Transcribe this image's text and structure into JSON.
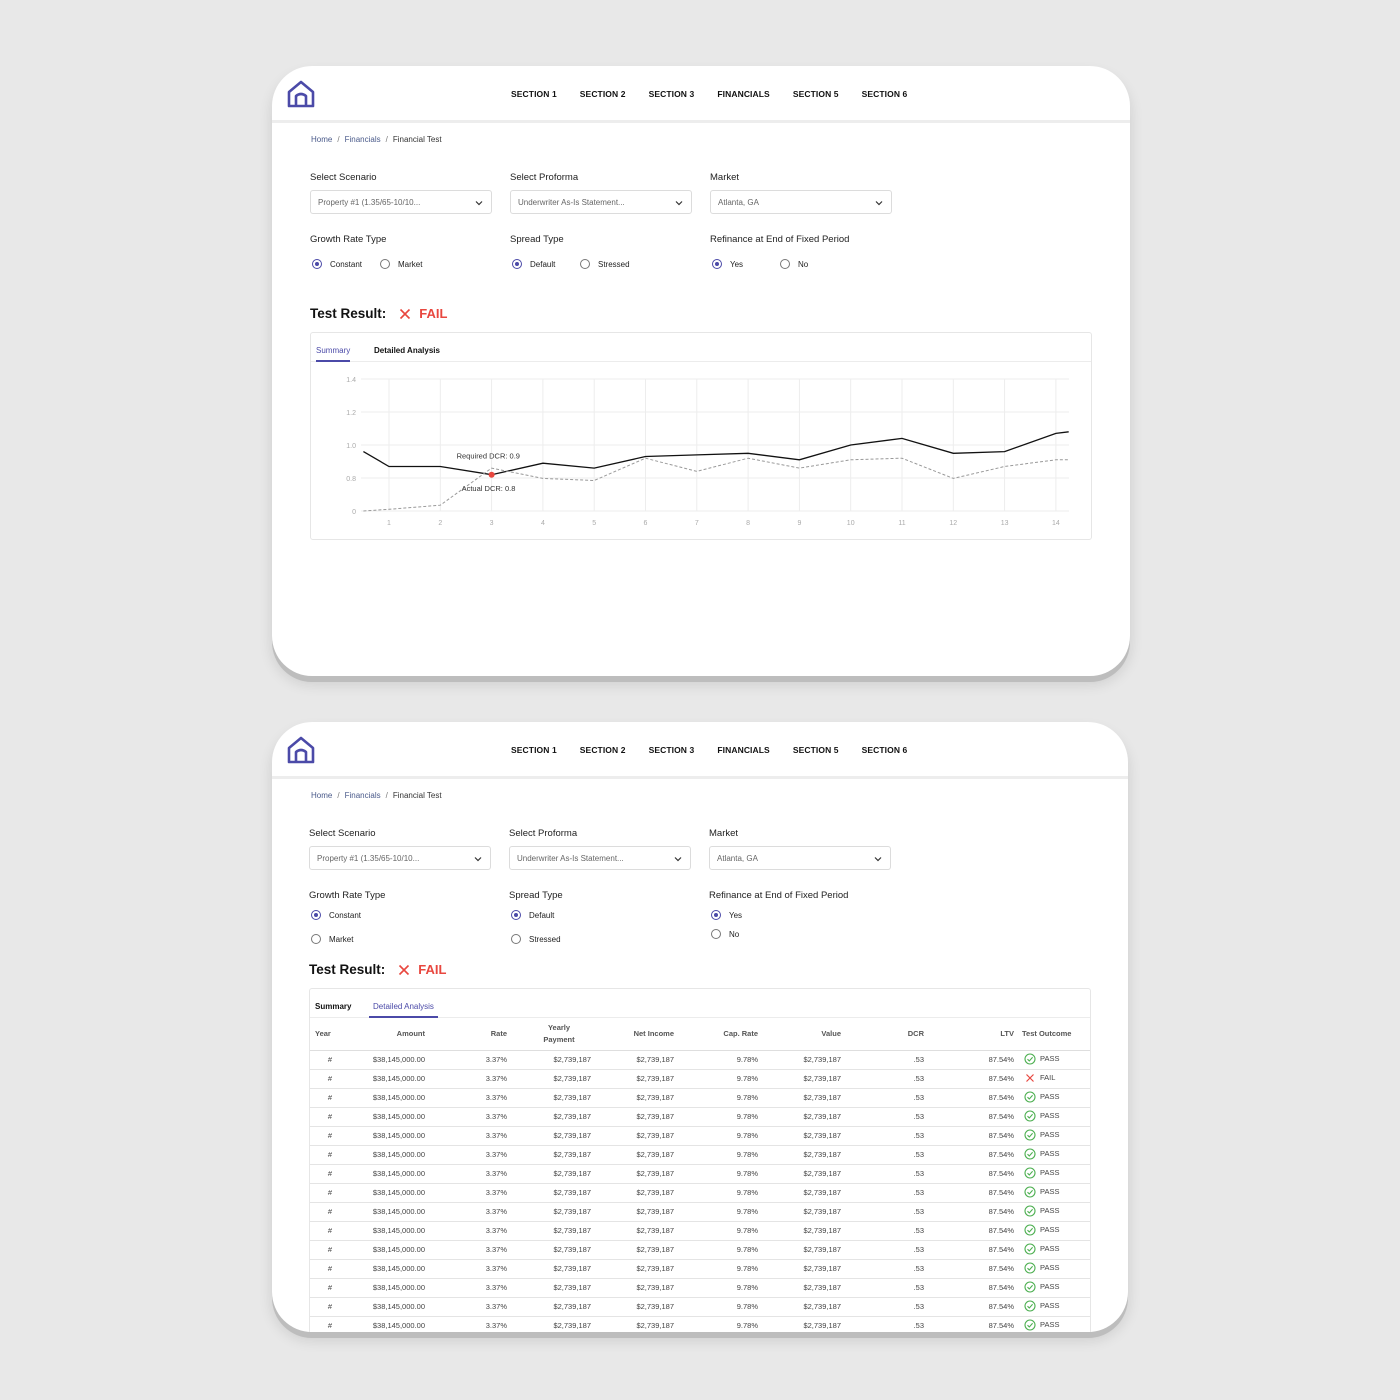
{
  "nav": {
    "logo_icon": "home-icon",
    "links": [
      "SECTION 1",
      "SECTION 2",
      "SECTION 3",
      "FINANCIALS",
      "SECTION 5",
      "SECTION 6"
    ]
  },
  "breadcrumb": {
    "home": "Home",
    "financials": "Financials",
    "current": "Financial Test",
    "sep": "/"
  },
  "filters": {
    "scenario_label": "Select Scenario",
    "scenario_value": "Property #1 (1.35/65-10/10...",
    "proforma_label": "Select Proforma",
    "proforma_value": "Underwriter As-Is Statement...",
    "market_label": "Market",
    "market_value": "Atlanta, GA",
    "growth_label": "Growth Rate Type",
    "growth_options": [
      "Constant",
      "Market"
    ],
    "growth_selected": "Constant",
    "spread_label": "Spread Type",
    "spread_options": [
      "Default",
      "Stressed"
    ],
    "spread_selected": "Default",
    "refi_label": "Refinance at End of Fixed Period",
    "refi_options": [
      "Yes",
      "No"
    ],
    "refi_selected": "Yes"
  },
  "result": {
    "label": "Test Result:",
    "status": "FAIL",
    "status_color": "#e8473f"
  },
  "tabs": {
    "summary": "Summary",
    "detailed": "Detailed Analysis"
  },
  "colors": {
    "accent": "#4b4aa8",
    "pass": "#4caf50",
    "fail": "#e8473f"
  },
  "chart_data": {
    "type": "line",
    "x": [
      0.5,
      1,
      2,
      3,
      4,
      5,
      6,
      7,
      8,
      9,
      10,
      11,
      12,
      13,
      14,
      14.25
    ],
    "x_tick_labels": [
      "1",
      "2",
      "3",
      "4",
      "5",
      "6",
      "7",
      "8",
      "9",
      "10",
      "11",
      "12",
      "13",
      "14"
    ],
    "y_tick_labels": [
      "0",
      "0.8",
      "1.0",
      "1.2",
      "1.4"
    ],
    "series": [
      {
        "style": "solid",
        "color": "#111111",
        "values": [
          0.96,
          0.87,
          0.87,
          0.82,
          0.89,
          0.86,
          0.93,
          0.94,
          0.95,
          0.91,
          1.0,
          1.04,
          0.95,
          0.96,
          1.07,
          1.08
        ]
      },
      {
        "style": "dashed",
        "color": "#999999",
        "values": [
          0.0,
          0.04,
          0.14,
          0.86,
          0.79,
          0.74,
          0.92,
          0.84,
          0.92,
          0.86,
          0.91,
          0.92,
          0.79,
          0.87,
          0.91,
          0.91
        ]
      }
    ],
    "annotations": [
      {
        "text": "Required DCR: 0.9"
      },
      {
        "text": "Actual DCR: 0.8"
      }
    ],
    "highlight": {
      "x": 3,
      "y": 0.82,
      "color": "#e8473f"
    },
    "grid": true
  },
  "table": {
    "headers": [
      "Year",
      "Amount",
      "Rate",
      "Yearly Payment",
      "Net Income",
      "Cap. Rate",
      "Value",
      "DCR",
      "LTV",
      "Test Outcome"
    ],
    "rows": [
      [
        "#",
        "$38,145,000.00",
        "3.37%",
        "$2,739,187",
        "$2,739,187",
        "9.78%",
        "$2,739,187",
        ".53",
        "87.54%",
        "PASS"
      ],
      [
        "#",
        "$38,145,000.00",
        "3.37%",
        "$2,739,187",
        "$2,739,187",
        "9.78%",
        "$2,739,187",
        ".53",
        "87.54%",
        "FAIL"
      ],
      [
        "#",
        "$38,145,000.00",
        "3.37%",
        "$2,739,187",
        "$2,739,187",
        "9.78%",
        "$2,739,187",
        ".53",
        "87.54%",
        "PASS"
      ],
      [
        "#",
        "$38,145,000.00",
        "3.37%",
        "$2,739,187",
        "$2,739,187",
        "9.78%",
        "$2,739,187",
        ".53",
        "87.54%",
        "PASS"
      ],
      [
        "#",
        "$38,145,000.00",
        "3.37%",
        "$2,739,187",
        "$2,739,187",
        "9.78%",
        "$2,739,187",
        ".53",
        "87.54%",
        "PASS"
      ],
      [
        "#",
        "$38,145,000.00",
        "3.37%",
        "$2,739,187",
        "$2,739,187",
        "9.78%",
        "$2,739,187",
        ".53",
        "87.54%",
        "PASS"
      ],
      [
        "#",
        "$38,145,000.00",
        "3.37%",
        "$2,739,187",
        "$2,739,187",
        "9.78%",
        "$2,739,187",
        ".53",
        "87.54%",
        "PASS"
      ],
      [
        "#",
        "$38,145,000.00",
        "3.37%",
        "$2,739,187",
        "$2,739,187",
        "9.78%",
        "$2,739,187",
        ".53",
        "87.54%",
        "PASS"
      ],
      [
        "#",
        "$38,145,000.00",
        "3.37%",
        "$2,739,187",
        "$2,739,187",
        "9.78%",
        "$2,739,187",
        ".53",
        "87.54%",
        "PASS"
      ],
      [
        "#",
        "$38,145,000.00",
        "3.37%",
        "$2,739,187",
        "$2,739,187",
        "9.78%",
        "$2,739,187",
        ".53",
        "87.54%",
        "PASS"
      ],
      [
        "#",
        "$38,145,000.00",
        "3.37%",
        "$2,739,187",
        "$2,739,187",
        "9.78%",
        "$2,739,187",
        ".53",
        "87.54%",
        "PASS"
      ],
      [
        "#",
        "$38,145,000.00",
        "3.37%",
        "$2,739,187",
        "$2,739,187",
        "9.78%",
        "$2,739,187",
        ".53",
        "87.54%",
        "PASS"
      ],
      [
        "#",
        "$38,145,000.00",
        "3.37%",
        "$2,739,187",
        "$2,739,187",
        "9.78%",
        "$2,739,187",
        ".53",
        "87.54%",
        "PASS"
      ],
      [
        "#",
        "$38,145,000.00",
        "3.37%",
        "$2,739,187",
        "$2,739,187",
        "9.78%",
        "$2,739,187",
        ".53",
        "87.54%",
        "PASS"
      ],
      [
        "#",
        "$38,145,000.00",
        "3.37%",
        "$2,739,187",
        "$2,739,187",
        "9.78%",
        "$2,739,187",
        ".53",
        "87.54%",
        "PASS"
      ]
    ]
  }
}
